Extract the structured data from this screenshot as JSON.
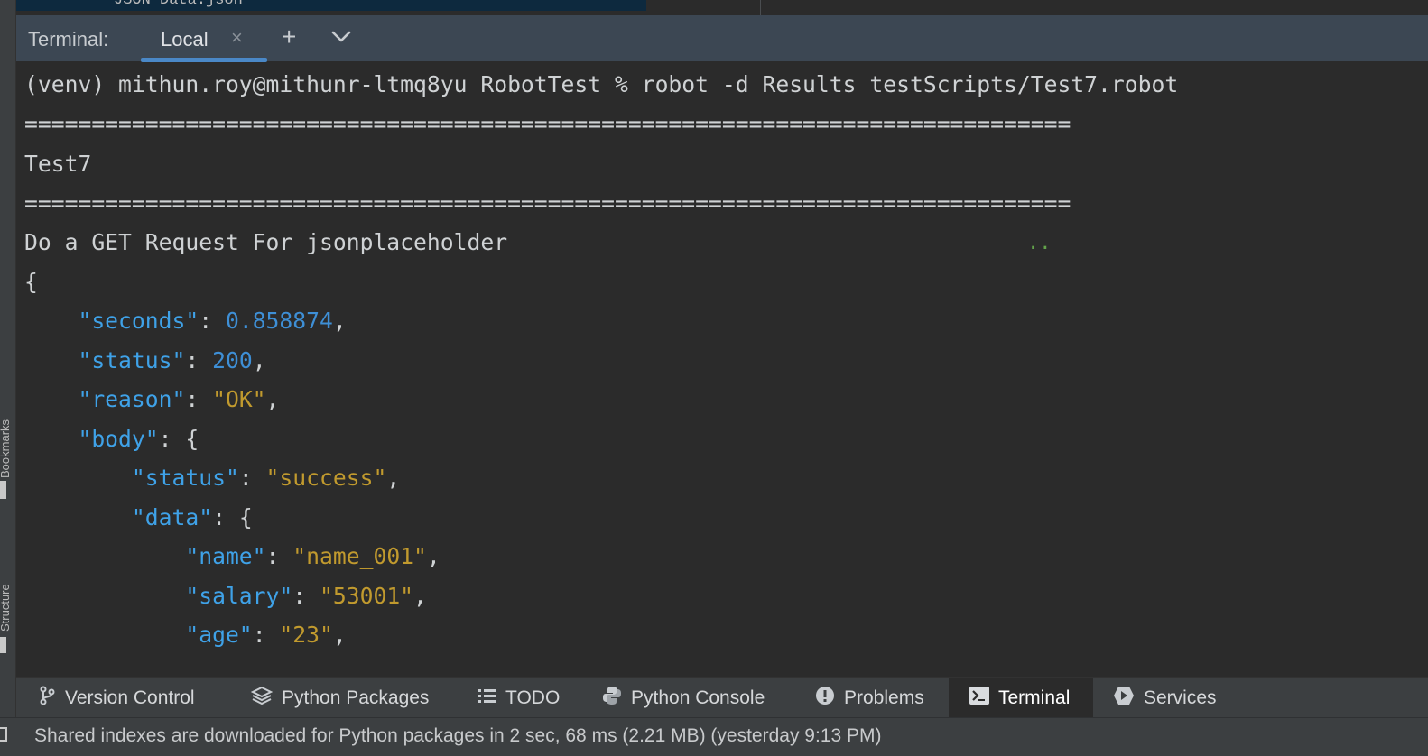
{
  "top_strip": {
    "file_name": "JSON_Data.json"
  },
  "side_panel": {
    "bookmarks_label": "Bookmarks",
    "structure_label": "Structure"
  },
  "terminal": {
    "title": "Terminal:",
    "tabs": [
      {
        "label": "Local",
        "active": true
      }
    ],
    "add_tab_icon": "plus-icon",
    "dropdown_icon": "chevron-down-icon"
  },
  "output": {
    "command_line": "(venv) mithun.roy@mithunr-ltmq8yu RobotTest % robot -d Results testScripts/Test7.robot",
    "separator": "==============================================================================",
    "suite_name": "Test7",
    "test_case": "Do a GET Request For jsonplaceholder",
    "progress_dots": "..",
    "json_open": "{",
    "seconds_key": "\"seconds\"",
    "seconds_value": "0.858874",
    "status_key": "\"status\"",
    "status_value": "200",
    "reason_key": "\"reason\"",
    "reason_value": "\"OK\"",
    "body_key": "\"body\"",
    "body_status_key": "\"status\"",
    "body_status_value": "\"success\"",
    "data_key": "\"data\"",
    "name_key": "\"name\"",
    "name_value": "\"name_001\"",
    "salary_key": "\"salary\"",
    "salary_value": "\"53001\"",
    "age_key": "\"age\"",
    "age_value": "\"23\"",
    "colon": ": ",
    "comma": ",",
    "brace_open": "{"
  },
  "tool_windows": [
    {
      "label": "Version Control",
      "icon": "branch-icon"
    },
    {
      "label": "Python Packages",
      "icon": "layers-icon"
    },
    {
      "label": "TODO",
      "icon": "list-icon"
    },
    {
      "label": "Python Console",
      "icon": "python-icon"
    },
    {
      "label": "Problems",
      "icon": "warning-icon"
    },
    {
      "label": "Terminal",
      "icon": "terminal-icon",
      "active": true
    },
    {
      "label": "Services",
      "icon": "services-icon"
    }
  ],
  "status_bar": {
    "message": "Shared indexes are downloaded for Python packages in 2 sec, 68 ms (2.21 MB) (yesterday 9:13 PM)"
  },
  "colors": {
    "json_key": "#3fa2e8",
    "json_number": "#3e8fd6",
    "json_string": "#c19a2e",
    "tab_underline": "#4a88c7"
  }
}
